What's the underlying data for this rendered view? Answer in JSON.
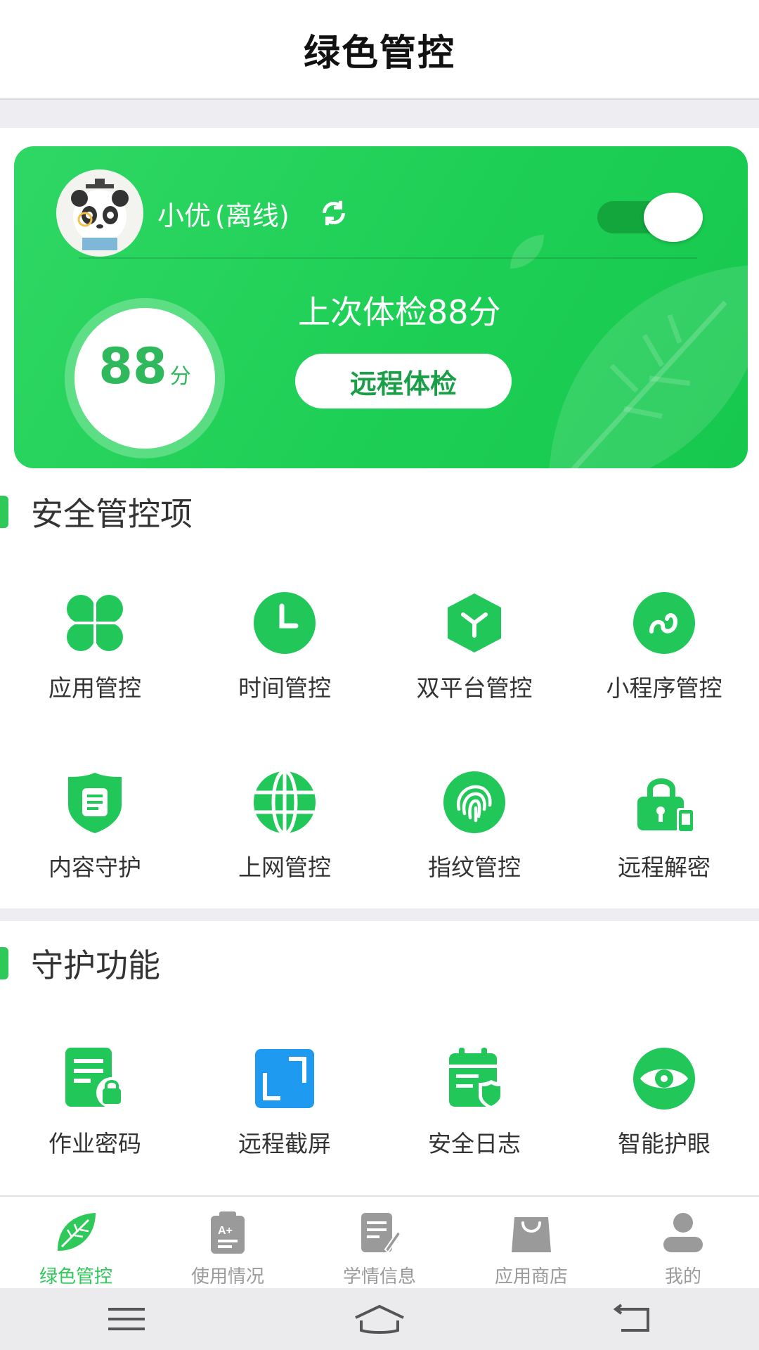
{
  "header": {
    "title": "绿色管控"
  },
  "status_card": {
    "child_name": "小优",
    "child_status": "(离线)",
    "score": "88",
    "score_unit": "分",
    "last_check_text": "上次体检88分",
    "remote_check_label": "远程体检",
    "toggle_on": true
  },
  "security_section": {
    "title": "安全管控项",
    "items": [
      {
        "label": "应用管控",
        "icon": "apps-grid-icon"
      },
      {
        "label": "时间管控",
        "icon": "clock-icon"
      },
      {
        "label": "双平台管控",
        "icon": "cube-icon"
      },
      {
        "label": "小程序管控",
        "icon": "mini-program-icon"
      },
      {
        "label": "内容守护",
        "icon": "shield-document-icon"
      },
      {
        "label": "上网管控",
        "icon": "globe-icon"
      },
      {
        "label": "指纹管控",
        "icon": "fingerprint-icon"
      },
      {
        "label": "远程解密",
        "icon": "lock-phone-icon"
      }
    ]
  },
  "guard_section": {
    "title": "守护功能",
    "items": [
      {
        "label": "作业密码",
        "icon": "homework-lock-icon"
      },
      {
        "label": "远程截屏",
        "icon": "screenshot-icon"
      },
      {
        "label": "安全日志",
        "icon": "calendar-shield-icon"
      },
      {
        "label": "智能护眼",
        "icon": "eye-icon"
      }
    ]
  },
  "bottom_nav": {
    "items": [
      {
        "label": "绿色管控",
        "active": true
      },
      {
        "label": "使用情况",
        "active": false
      },
      {
        "label": "学情信息",
        "active": false
      },
      {
        "label": "应用商店",
        "active": false
      },
      {
        "label": "我的",
        "active": false
      }
    ]
  },
  "colors": {
    "brand_green": "#2fc95a",
    "inactive_gray": "#9a9a9a",
    "screenshot_blue": "#1e9bf0"
  }
}
